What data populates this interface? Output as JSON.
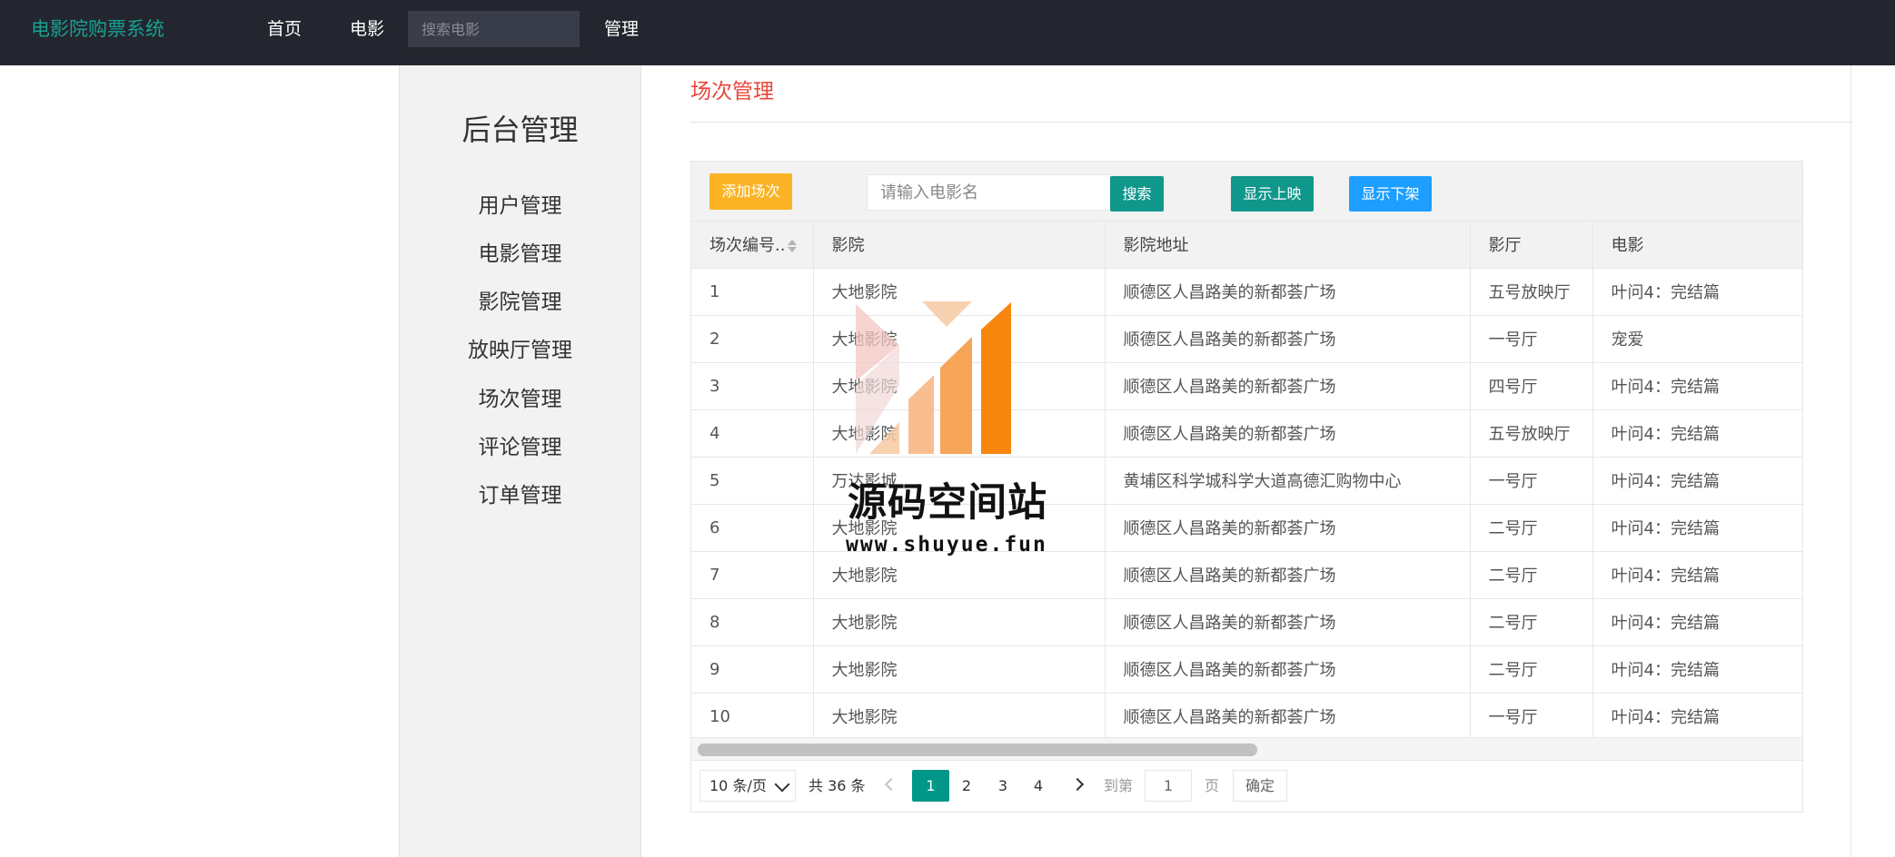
{
  "nav": {
    "brand": "电影院购票系统",
    "home": "首页",
    "movies": "电影",
    "search_placeholder": "搜索电影",
    "admin": "管理"
  },
  "sidebar": {
    "title": "后台管理",
    "items": [
      {
        "label": "用户管理"
      },
      {
        "label": "电影管理"
      },
      {
        "label": "影院管理"
      },
      {
        "label": "放映厅管理"
      },
      {
        "label": "场次管理"
      },
      {
        "label": "评论管理"
      },
      {
        "label": "订单管理"
      }
    ]
  },
  "main": {
    "title": "场次管理",
    "toolbar": {
      "add_label": "添加场次",
      "search_placeholder": "请输入电影名",
      "search_label": "搜索",
      "show_on_label": "显示上映",
      "show_off_label": "显示下架"
    },
    "table": {
      "headers": [
        "场次编号..",
        "影院",
        "影院地址",
        "影厅",
        "电影"
      ],
      "rows": [
        [
          "1",
          "大地影院",
          "顺德区人昌路美的新都荟广场",
          "五号放映厅",
          "叶问4：完结篇"
        ],
        [
          "2",
          "大地影院",
          "顺德区人昌路美的新都荟广场",
          "一号厅",
          "宠爱"
        ],
        [
          "3",
          "大地影院",
          "顺德区人昌路美的新都荟广场",
          "四号厅",
          "叶问4：完结篇"
        ],
        [
          "4",
          "大地影院",
          "顺德区人昌路美的新都荟广场",
          "五号放映厅",
          "叶问4：完结篇"
        ],
        [
          "5",
          "万达影城",
          "黄埔区科学城科学大道高德汇购物中心",
          "一号厅",
          "叶问4：完结篇"
        ],
        [
          "6",
          "大地影院",
          "顺德区人昌路美的新都荟广场",
          "二号厅",
          "叶问4：完结篇"
        ],
        [
          "7",
          "大地影院",
          "顺德区人昌路美的新都荟广场",
          "二号厅",
          "叶问4：完结篇"
        ],
        [
          "8",
          "大地影院",
          "顺德区人昌路美的新都荟广场",
          "二号厅",
          "叶问4：完结篇"
        ],
        [
          "9",
          "大地影院",
          "顺德区人昌路美的新都荟广场",
          "二号厅",
          "叶问4：完结篇"
        ],
        [
          "10",
          "大地影院",
          "顺德区人昌路美的新都荟广场",
          "一号厅",
          "叶问4：完结篇"
        ]
      ]
    },
    "pager": {
      "limit": "10 条/页",
      "total": "共 36 条",
      "pages": [
        "1",
        "2",
        "3",
        "4"
      ],
      "current": "1",
      "goto_label": "到第",
      "goto_value": "1",
      "unit_label": "页",
      "confirm_label": "确定"
    }
  },
  "watermark": {
    "text": "源码空间站",
    "url": "www.shuyue.fun"
  },
  "colors": {
    "topbar": "#23262e",
    "brand": "#1aa094",
    "title_red": "#e8473a",
    "add_button": "#fbb325",
    "teal_button": "#10978b",
    "blue_button": "#1e9fff"
  }
}
